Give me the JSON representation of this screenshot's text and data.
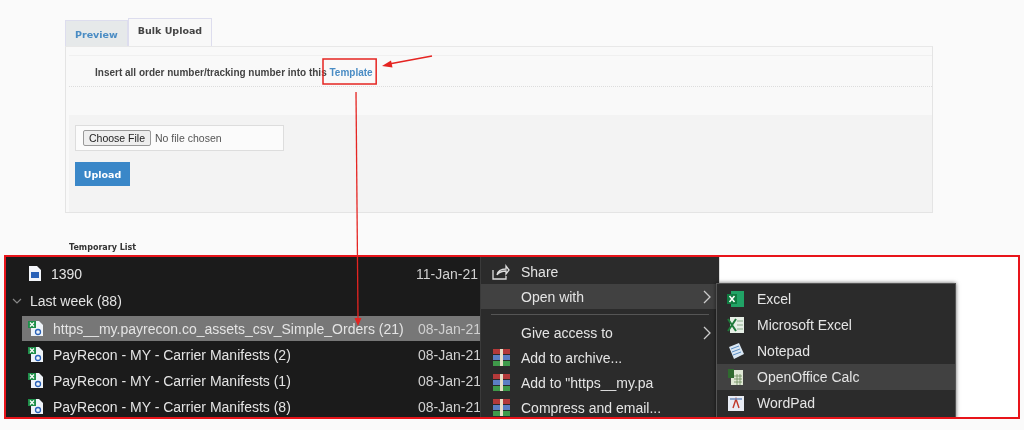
{
  "tabs": [
    {
      "label": "Preview",
      "selected": false
    },
    {
      "label": "Bulk Upload",
      "selected": true
    }
  ],
  "instruction": {
    "text": "Insert all order number/tracking number into this",
    "link": "Template"
  },
  "file_input": {
    "button": "Choose File",
    "status": "No file chosen"
  },
  "upload_button": "Upload",
  "section_title": "Temporary List",
  "explorer": {
    "items": [
      {
        "kind": "file",
        "name": "1390",
        "date": "11-Jan-21",
        "selected": false
      },
      {
        "kind": "group",
        "name": "Last week (88)",
        "expanded": true,
        "children": [
          {
            "kind": "file",
            "name": "https__my.payrecon.co_assets_csv_Simple_Orders (21)",
            "date": "08-Jan-21",
            "selected": true
          },
          {
            "kind": "file",
            "name": "PayRecon - MY - Carrier Manifests (2)",
            "date": "08-Jan-21",
            "selected": false
          },
          {
            "kind": "file",
            "name": "PayRecon - MY - Carrier Manifests (1)",
            "date": "08-Jan-21",
            "selected": false
          },
          {
            "kind": "file",
            "name": "PayRecon - MY - Carrier Manifests (8)",
            "date": "08-Jan-21",
            "selected": false
          }
        ]
      }
    ]
  },
  "context_menu": [
    {
      "kind": "share",
      "label": "Share",
      "submenu": false,
      "selected": false
    },
    {
      "kind": "plain",
      "label": "Open with",
      "submenu": true,
      "selected": true
    },
    {
      "kind": "separator"
    },
    {
      "kind": "plain",
      "label": "Give access to",
      "submenu": true,
      "selected": false
    },
    {
      "kind": "archive",
      "label": "Add to archive...",
      "submenu": false,
      "selected": false
    },
    {
      "kind": "archive",
      "label": "Add to \"https__my.pa",
      "submenu": false,
      "selected": false
    },
    {
      "kind": "archive",
      "label": "Compress and email...",
      "submenu": false,
      "selected": false
    }
  ],
  "open_with_menu": [
    {
      "kind": "excel",
      "label": "Excel",
      "selected": false
    },
    {
      "kind": "excel-classic",
      "label": "Microsoft Excel",
      "selected": false
    },
    {
      "kind": "notepad",
      "label": "Notepad",
      "selected": false
    },
    {
      "kind": "calc",
      "label": "OpenOffice Calc",
      "selected": true
    },
    {
      "kind": "wordpad",
      "label": "WordPad",
      "selected": false
    }
  ]
}
